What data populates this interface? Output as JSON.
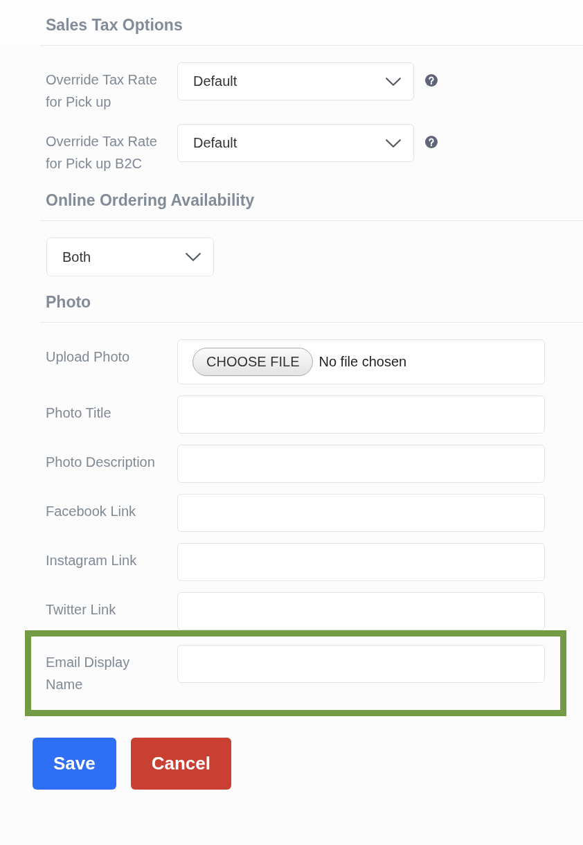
{
  "sections": [
    {
      "title": "Sales Tax Options",
      "rows": [
        {
          "kind": "select",
          "label": "Override Tax Rate for Pick up",
          "value": "Default",
          "help": true,
          "highlighted": false
        },
        {
          "kind": "select",
          "label": "Override Tax Rate for Pick up B2C",
          "value": "Default",
          "help": true,
          "highlighted": false
        }
      ]
    },
    {
      "title": "Online Ordering Availability",
      "rows": [
        {
          "kind": "select",
          "value": "Both",
          "help": false,
          "highlighted": false
        }
      ]
    },
    {
      "title": "Photo",
      "rows": [
        {
          "kind": "file",
          "label": "Upload Photo",
          "button": "CHOOSE FILE",
          "status": "No file chosen",
          "highlighted": false
        },
        {
          "kind": "text",
          "label": "Photo Title",
          "highlighted": false
        },
        {
          "kind": "text",
          "label": "Photo Description",
          "highlighted": false
        },
        {
          "kind": "text",
          "label": "Facebook Link",
          "highlighted": false
        },
        {
          "kind": "text",
          "label": "Instagram Link",
          "highlighted": false
        },
        {
          "kind": "text",
          "label": "Twitter Link",
          "highlighted": false
        },
        {
          "kind": "text",
          "label": "Email Display Name",
          "highlighted": true
        }
      ]
    }
  ],
  "buttons": [
    {
      "label": "Save",
      "kind": "primary"
    },
    {
      "label": "Cancel",
      "kind": "danger"
    }
  ]
}
